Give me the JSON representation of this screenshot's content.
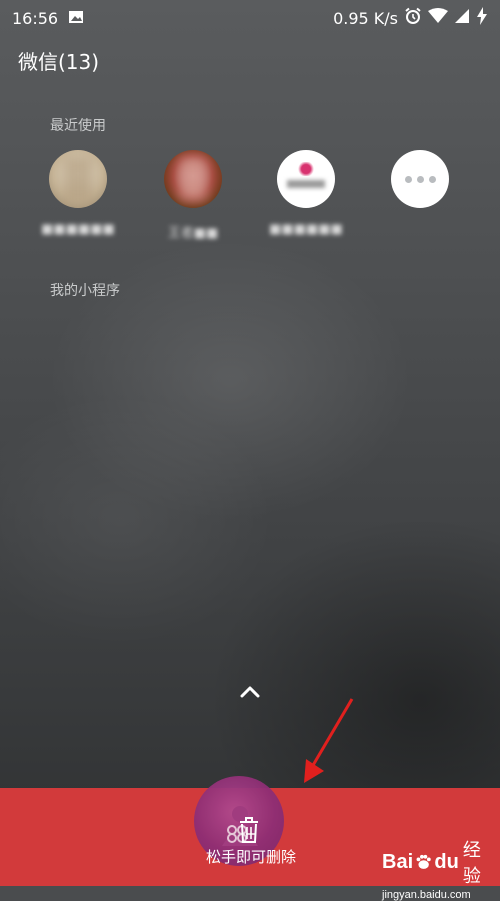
{
  "status_bar": {
    "time": "16:56",
    "network_speed": "0.95 K/s",
    "icons": [
      "image-icon",
      "alarm-icon",
      "wifi-icon",
      "signal-icon",
      "charging-icon"
    ]
  },
  "app_title": "微信(13)",
  "recent_section": {
    "label": "最近使用",
    "items": [
      {
        "icon": "mini-program-avatar-1",
        "name": "■■■■■■"
      },
      {
        "icon": "mini-program-avatar-2",
        "name": "王者■■"
      },
      {
        "icon": "mini-program-avatar-3",
        "name": "■■■■■■"
      },
      {
        "icon": "more-icon",
        "name": ""
      }
    ]
  },
  "my_section": {
    "label": "我的小程序"
  },
  "delete_bar": {
    "label": "松手即可删除",
    "color": "#d23a3b"
  },
  "watermark": {
    "brand": "Bai",
    "brand2": "du",
    "brand_cn": "经验",
    "url": "jingyan.baidu.com"
  }
}
